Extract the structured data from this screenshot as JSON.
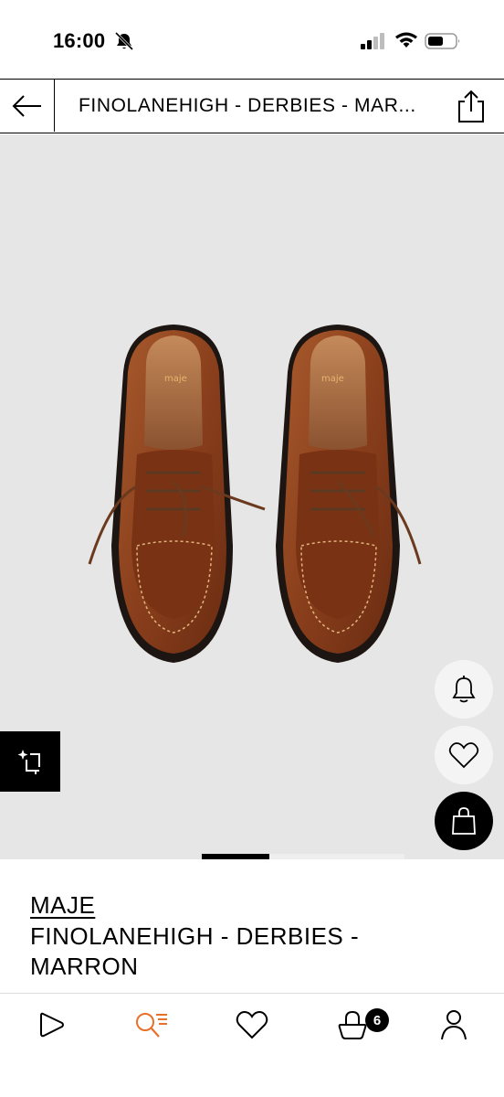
{
  "status_bar": {
    "time": "16:00"
  },
  "header": {
    "title": "FINOLANEHIGH - DERBIES - MAR..."
  },
  "product": {
    "brand": "MAJE",
    "name": "FINOLANEHIGH - DERBIES - MARRON",
    "insole_logo": "maje",
    "image_carousel": {
      "active_index": 1,
      "total": 3
    }
  },
  "bottom_nav": {
    "cart_count": "6",
    "active_item": "search"
  },
  "colors": {
    "accent": "#e8702a",
    "background_image": "#e6e6e6",
    "leather": "#8a3f1c",
    "text": "#000000"
  },
  "icons": [
    "bell-off-icon",
    "signal-icon",
    "wifi-icon",
    "battery-icon",
    "back-arrow-icon",
    "share-icon",
    "ai-crop-icon",
    "bell-icon",
    "heart-icon",
    "shopping-bag-icon",
    "home-play-icon",
    "search-list-icon",
    "heart-icon",
    "basket-icon",
    "user-icon"
  ]
}
